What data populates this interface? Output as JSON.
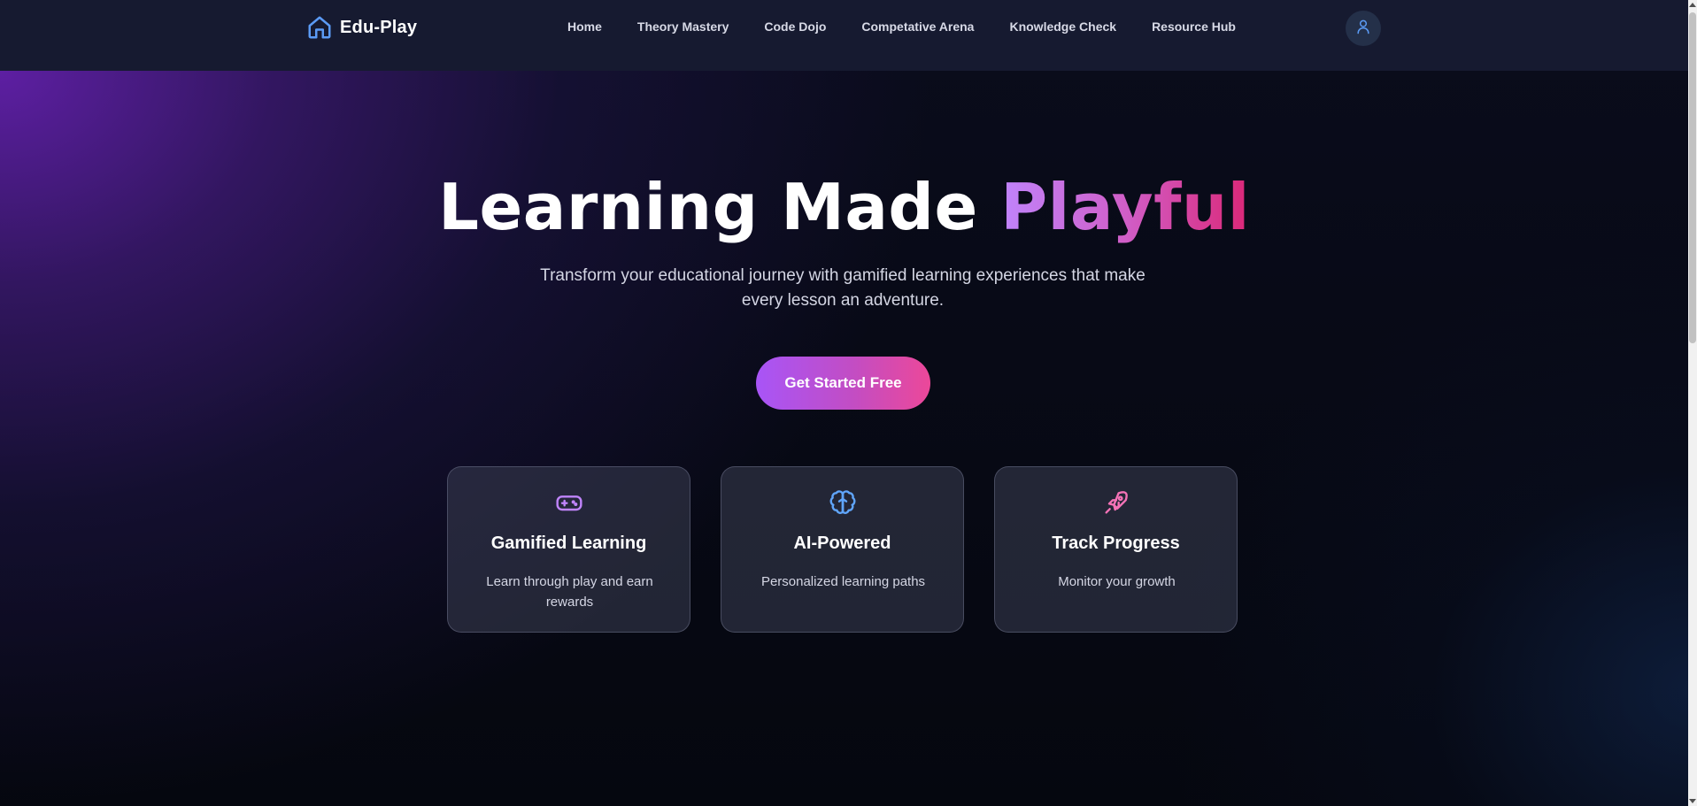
{
  "brand": {
    "name": "Edu-Play",
    "icon": "home-icon",
    "color": "#5b9bf5"
  },
  "nav": {
    "links": [
      "Home",
      "Theory Mastery",
      "Code Dojo",
      "Competative Arena",
      "Knowledge Check",
      "Resource Hub"
    ]
  },
  "user": {
    "icon": "user-icon"
  },
  "hero": {
    "title_plain": "Learning Made ",
    "title_accent": "Playful",
    "subtitle": "Transform your educational journey with gamified learning experiences that make every lesson an adventure.",
    "cta_label": "Get Started Free"
  },
  "features": [
    {
      "icon": "gamepad-icon",
      "icon_color": "#c084fc",
      "title": "Gamified Learning",
      "description": "Learn through play and earn rewards"
    },
    {
      "icon": "brain-icon",
      "icon_color": "#60a5fa",
      "title": "AI-Powered",
      "description": "Personalized learning paths"
    },
    {
      "icon": "rocket-icon",
      "icon_color": "#f472b6",
      "title": "Track Progress",
      "description": "Monitor your growth"
    }
  ],
  "colors": {
    "accent_start": "#a855f7",
    "accent_end": "#ec4899",
    "navbar_bg": "#161a30"
  }
}
